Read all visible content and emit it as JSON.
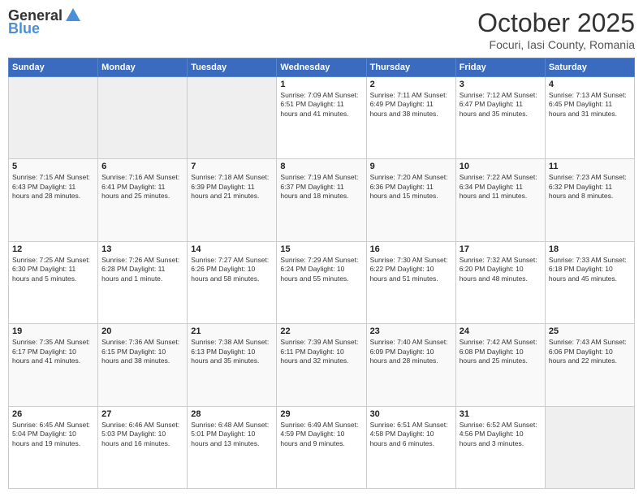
{
  "header": {
    "logo_general": "General",
    "logo_blue": "Blue",
    "month": "October 2025",
    "location": "Focuri, Iasi County, Romania"
  },
  "weekdays": [
    "Sunday",
    "Monday",
    "Tuesday",
    "Wednesday",
    "Thursday",
    "Friday",
    "Saturday"
  ],
  "weeks": [
    [
      {
        "day": "",
        "info": ""
      },
      {
        "day": "",
        "info": ""
      },
      {
        "day": "",
        "info": ""
      },
      {
        "day": "1",
        "info": "Sunrise: 7:09 AM\nSunset: 6:51 PM\nDaylight: 11 hours and 41 minutes."
      },
      {
        "day": "2",
        "info": "Sunrise: 7:11 AM\nSunset: 6:49 PM\nDaylight: 11 hours and 38 minutes."
      },
      {
        "day": "3",
        "info": "Sunrise: 7:12 AM\nSunset: 6:47 PM\nDaylight: 11 hours and 35 minutes."
      },
      {
        "day": "4",
        "info": "Sunrise: 7:13 AM\nSunset: 6:45 PM\nDaylight: 11 hours and 31 minutes."
      }
    ],
    [
      {
        "day": "5",
        "info": "Sunrise: 7:15 AM\nSunset: 6:43 PM\nDaylight: 11 hours and 28 minutes."
      },
      {
        "day": "6",
        "info": "Sunrise: 7:16 AM\nSunset: 6:41 PM\nDaylight: 11 hours and 25 minutes."
      },
      {
        "day": "7",
        "info": "Sunrise: 7:18 AM\nSunset: 6:39 PM\nDaylight: 11 hours and 21 minutes."
      },
      {
        "day": "8",
        "info": "Sunrise: 7:19 AM\nSunset: 6:37 PM\nDaylight: 11 hours and 18 minutes."
      },
      {
        "day": "9",
        "info": "Sunrise: 7:20 AM\nSunset: 6:36 PM\nDaylight: 11 hours and 15 minutes."
      },
      {
        "day": "10",
        "info": "Sunrise: 7:22 AM\nSunset: 6:34 PM\nDaylight: 11 hours and 11 minutes."
      },
      {
        "day": "11",
        "info": "Sunrise: 7:23 AM\nSunset: 6:32 PM\nDaylight: 11 hours and 8 minutes."
      }
    ],
    [
      {
        "day": "12",
        "info": "Sunrise: 7:25 AM\nSunset: 6:30 PM\nDaylight: 11 hours and 5 minutes."
      },
      {
        "day": "13",
        "info": "Sunrise: 7:26 AM\nSunset: 6:28 PM\nDaylight: 11 hours and 1 minute."
      },
      {
        "day": "14",
        "info": "Sunrise: 7:27 AM\nSunset: 6:26 PM\nDaylight: 10 hours and 58 minutes."
      },
      {
        "day": "15",
        "info": "Sunrise: 7:29 AM\nSunset: 6:24 PM\nDaylight: 10 hours and 55 minutes."
      },
      {
        "day": "16",
        "info": "Sunrise: 7:30 AM\nSunset: 6:22 PM\nDaylight: 10 hours and 51 minutes."
      },
      {
        "day": "17",
        "info": "Sunrise: 7:32 AM\nSunset: 6:20 PM\nDaylight: 10 hours and 48 minutes."
      },
      {
        "day": "18",
        "info": "Sunrise: 7:33 AM\nSunset: 6:18 PM\nDaylight: 10 hours and 45 minutes."
      }
    ],
    [
      {
        "day": "19",
        "info": "Sunrise: 7:35 AM\nSunset: 6:17 PM\nDaylight: 10 hours and 41 minutes."
      },
      {
        "day": "20",
        "info": "Sunrise: 7:36 AM\nSunset: 6:15 PM\nDaylight: 10 hours and 38 minutes."
      },
      {
        "day": "21",
        "info": "Sunrise: 7:38 AM\nSunset: 6:13 PM\nDaylight: 10 hours and 35 minutes."
      },
      {
        "day": "22",
        "info": "Sunrise: 7:39 AM\nSunset: 6:11 PM\nDaylight: 10 hours and 32 minutes."
      },
      {
        "day": "23",
        "info": "Sunrise: 7:40 AM\nSunset: 6:09 PM\nDaylight: 10 hours and 28 minutes."
      },
      {
        "day": "24",
        "info": "Sunrise: 7:42 AM\nSunset: 6:08 PM\nDaylight: 10 hours and 25 minutes."
      },
      {
        "day": "25",
        "info": "Sunrise: 7:43 AM\nSunset: 6:06 PM\nDaylight: 10 hours and 22 minutes."
      }
    ],
    [
      {
        "day": "26",
        "info": "Sunrise: 6:45 AM\nSunset: 5:04 PM\nDaylight: 10 hours and 19 minutes."
      },
      {
        "day": "27",
        "info": "Sunrise: 6:46 AM\nSunset: 5:03 PM\nDaylight: 10 hours and 16 minutes."
      },
      {
        "day": "28",
        "info": "Sunrise: 6:48 AM\nSunset: 5:01 PM\nDaylight: 10 hours and 13 minutes."
      },
      {
        "day": "29",
        "info": "Sunrise: 6:49 AM\nSunset: 4:59 PM\nDaylight: 10 hours and 9 minutes."
      },
      {
        "day": "30",
        "info": "Sunrise: 6:51 AM\nSunset: 4:58 PM\nDaylight: 10 hours and 6 minutes."
      },
      {
        "day": "31",
        "info": "Sunrise: 6:52 AM\nSunset: 4:56 PM\nDaylight: 10 hours and 3 minutes."
      },
      {
        "day": "",
        "info": ""
      }
    ]
  ]
}
